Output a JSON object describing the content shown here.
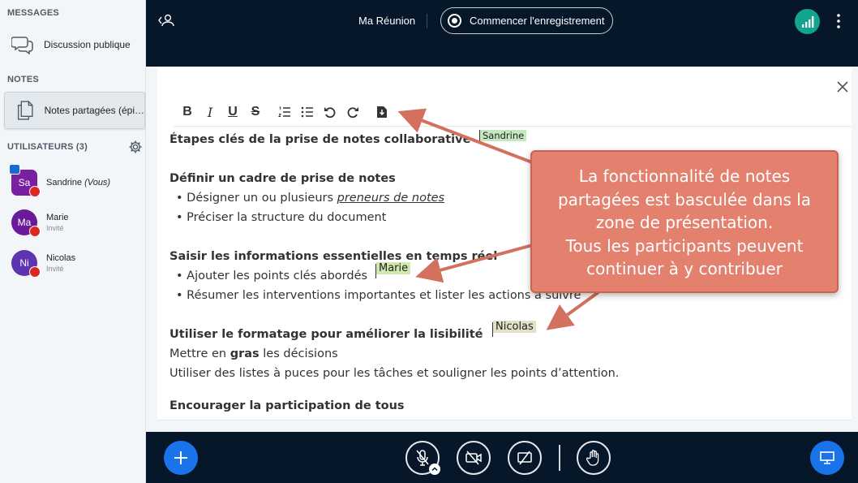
{
  "sidebar": {
    "messages_title": "MESSAGES",
    "public_chat_label": "Discussion publique",
    "notes_title": "NOTES",
    "shared_notes_label": "Notes partagées (épi…",
    "users_title": "UTILISATEURS (3)",
    "users": [
      {
        "initials": "Sa",
        "name": "Sandrine",
        "you": "(Vous)",
        "role": "",
        "color": "#7b1fa2"
      },
      {
        "initials": "Ma",
        "name": "Marie",
        "you": "",
        "role": "Invité",
        "color": "#6a1b9a"
      },
      {
        "initials": "Ni",
        "name": "Nicolas",
        "you": "",
        "role": "Invité",
        "color": "#5e35b1"
      }
    ]
  },
  "header": {
    "meeting_title": "Ma Réunion",
    "record_label": "Commencer l'enregistrement"
  },
  "toolbar": {
    "bold": "B",
    "italic": "I",
    "underline": "U",
    "strike": "S"
  },
  "document": {
    "l1": "Étapes clés de la prise de notes collaborative",
    "l2": "Définir un cadre de prise de notes",
    "l3_pre": "Désigner un ou plusieurs ",
    "l3_link": "preneurs de notes ",
    "l4": "Préciser la structure du document",
    "l5": "Saisir les informations essentielles en temps réel",
    "l6": "Ajouter les points clés abordés",
    "l7": "Résumer les interventions importantes et lister les actions à suivre",
    "l8": "Utiliser le formatage pour améliorer la lisibilité",
    "l9_pre": "Mettre en ",
    "l9_bold": "gras",
    "l9_post": " les décisions",
    "l10": "Utiliser des listes à puces pour les tâches et souligner les points d’attention.",
    "l11": "Encourager la participation de tous"
  },
  "cursor_tags": {
    "sandrine": "Sandrine",
    "marie": "Marie",
    "nicolas": "Nicolas"
  },
  "callout": {
    "line1": "La fonctionnalité de notes",
    "line2": "partagées est basculée dans la",
    "line3": "zone de présentation.",
    "line4": "Tous les participants peuvent",
    "line5": "continuer à y contribuer"
  },
  "colors": {
    "header_bg": "#06172a",
    "accent_blue": "#1a73e8",
    "connection_green": "#12a48f",
    "callout_bg": "#e3806e",
    "muted_red": "#df2721"
  }
}
